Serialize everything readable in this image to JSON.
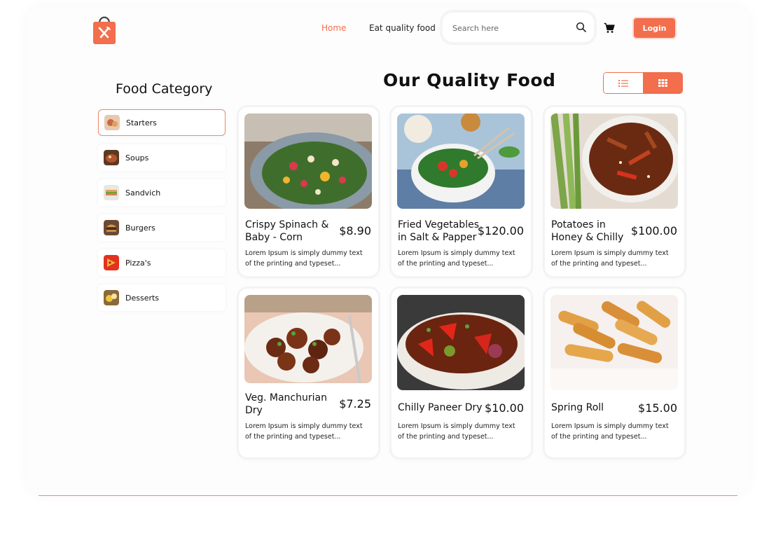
{
  "header": {
    "nav": {
      "home": "Home",
      "eat_quality": "Eat quality food"
    },
    "search": {
      "placeholder": "Search here",
      "value": ""
    },
    "login_label": "Login"
  },
  "sidebar": {
    "title": "Food Category",
    "items": [
      {
        "label": "Starters",
        "active": true
      },
      {
        "label": "Soups"
      },
      {
        "label": "Sandvich"
      },
      {
        "label": "Burgers"
      },
      {
        "label": "Pizza's"
      },
      {
        "label": "Desserts"
      }
    ]
  },
  "main": {
    "title": "Our Quality Food",
    "view_mode": "grid",
    "products": [
      {
        "name": "Crispy Spinach & Baby - Corn",
        "price": "$8.90",
        "desc_line1": "Lorem Ipsum is simply dummy text",
        "desc_line2": "of the printing and typeset..."
      },
      {
        "name": "Fried Vegetables in Salt & Papper",
        "price": "$120.00",
        "desc_line1": "Lorem Ipsum is simply dummy text",
        "desc_line2": "of the printing and typeset..."
      },
      {
        "name": "Potatoes in Honey & Chilly",
        "price": "$100.00",
        "desc_line1": "Lorem Ipsum is simply dummy text",
        "desc_line2": "of the printing and typeset..."
      },
      {
        "name": "Veg. Manchurian Dry",
        "price": "$7.25",
        "desc_line1": "Lorem Ipsum is simply dummy text",
        "desc_line2": "of the printing and typeset..."
      },
      {
        "name": "Chilly Paneer Dry",
        "price": "$10.00",
        "desc_line1": "Lorem Ipsum is simply dummy text",
        "desc_line2": "of the printing and typeset..."
      },
      {
        "name": "Spring Roll",
        "price": "$15.00",
        "desc_line1": "Lorem Ipsum is simply dummy text",
        "desc_line2": "of the printing and typeset..."
      }
    ]
  },
  "colors": {
    "accent": "#f26e4c",
    "text": "#111111",
    "panel": "#fdfdfd"
  },
  "icons": [
    "shopping-bag-logo-icon",
    "search-icon",
    "cart-icon",
    "list-view-icon",
    "grid-view-icon"
  ]
}
